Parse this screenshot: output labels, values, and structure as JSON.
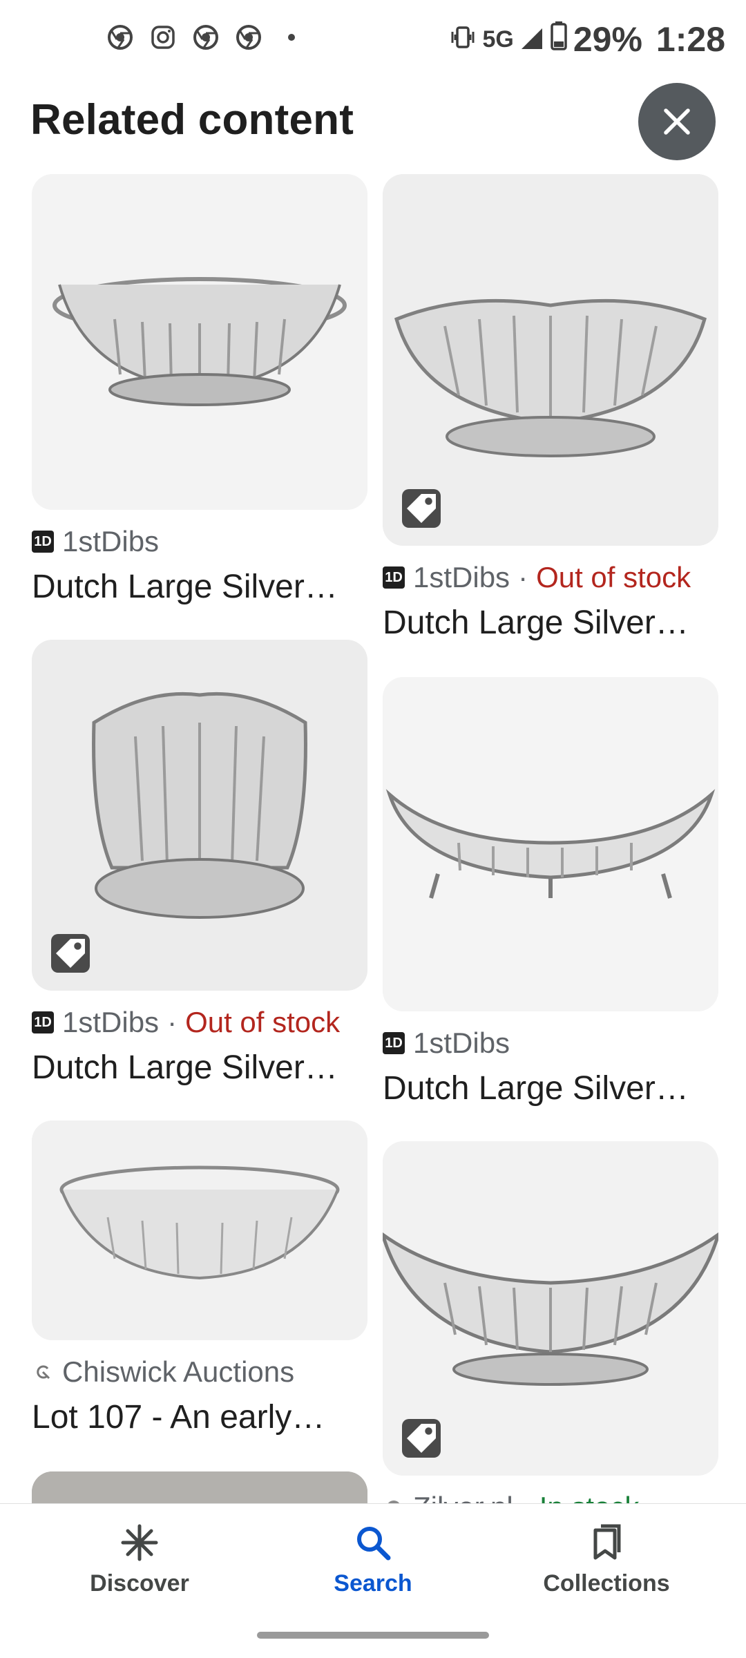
{
  "status_bar": {
    "icons_left": [
      "chrome-icon",
      "instagram-icon",
      "chrome-icon",
      "chrome-icon",
      "dot-icon"
    ],
    "network": "5G",
    "battery": "29%",
    "time": "1:28"
  },
  "header": {
    "title": "Related content",
    "close_icon": "close-icon"
  },
  "cards": [
    {
      "source": "1stDibs",
      "stock": "",
      "title": "Dutch Large Silver…",
      "has_tag": false,
      "favicon": "1D"
    },
    {
      "source": "1stDibs",
      "stock": "Out of stock",
      "title": "Dutch Large Silver…",
      "has_tag": true,
      "favicon": "1D"
    },
    {
      "source": "1stDibs",
      "stock": "Out of stock",
      "title": "Dutch Large Silver…",
      "has_tag": true,
      "favicon": "1D"
    },
    {
      "source": "1stDibs",
      "stock": "",
      "title": "Dutch Large Silver…",
      "has_tag": false,
      "favicon": "1D"
    },
    {
      "source": "Chiswick Auctions",
      "stock": "",
      "title": "Lot 107 - An early…",
      "has_tag": false,
      "favicon": "auction-icon"
    },
    {
      "source": "Zilver.nl",
      "stock": "In stock",
      "title": "",
      "has_tag": true,
      "favicon": "globe-icon"
    }
  ],
  "separator": "·",
  "nav": {
    "items": [
      {
        "label": "Discover",
        "icon": "asterisk-icon"
      },
      {
        "label": "Search",
        "icon": "search-icon",
        "active": true
      },
      {
        "label": "Collections",
        "icon": "collections-icon"
      }
    ]
  },
  "colors": {
    "out_of_stock": "#b3261e",
    "in_stock": "#188038",
    "active_nav": "#0b57d0",
    "close_button_bg": "#555a5e"
  }
}
